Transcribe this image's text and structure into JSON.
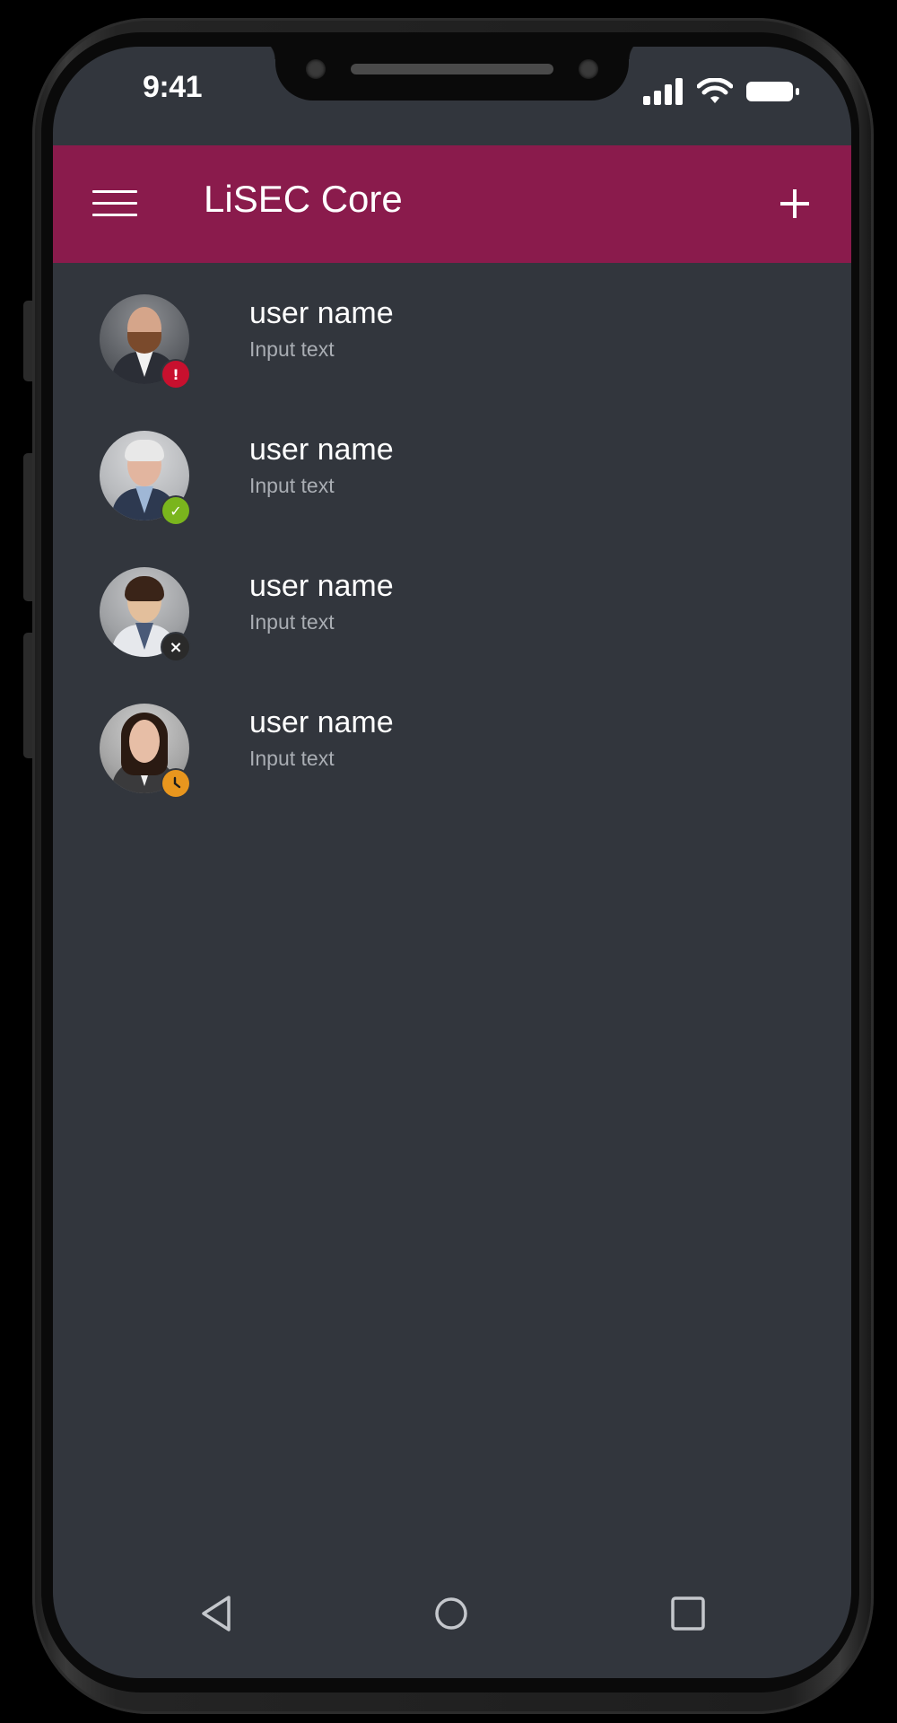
{
  "status_bar": {
    "time": "9:41",
    "icons": [
      "signal-icon",
      "wifi-icon",
      "battery-icon"
    ]
  },
  "app_bar": {
    "title": "LiSEC Core",
    "background_color": "#8a1b4c",
    "menu_icon": "hamburger-menu-icon",
    "add_icon": "plus-icon"
  },
  "users": [
    {
      "name": "user name",
      "subtitle": "Input text",
      "status": "error",
      "status_glyph": "!",
      "status_color": "#c8102e"
    },
    {
      "name": "user name",
      "subtitle": "Input text",
      "status": "available",
      "status_glyph": "✓",
      "status_color": "#7ab51d"
    },
    {
      "name": "user name",
      "subtitle": "Input text",
      "status": "offline",
      "status_glyph": "×",
      "status_color": "#2a2a2a"
    },
    {
      "name": "user name",
      "subtitle": "Input text",
      "status": "away",
      "status_glyph": "clock",
      "status_color": "#e8961e"
    }
  ],
  "nav_bar": {
    "buttons": [
      "back-triangle-icon",
      "home-circle-icon",
      "recents-square-icon"
    ]
  },
  "theme": {
    "screen_background": "#32363d",
    "subtitle_color": "#a9adb3"
  }
}
